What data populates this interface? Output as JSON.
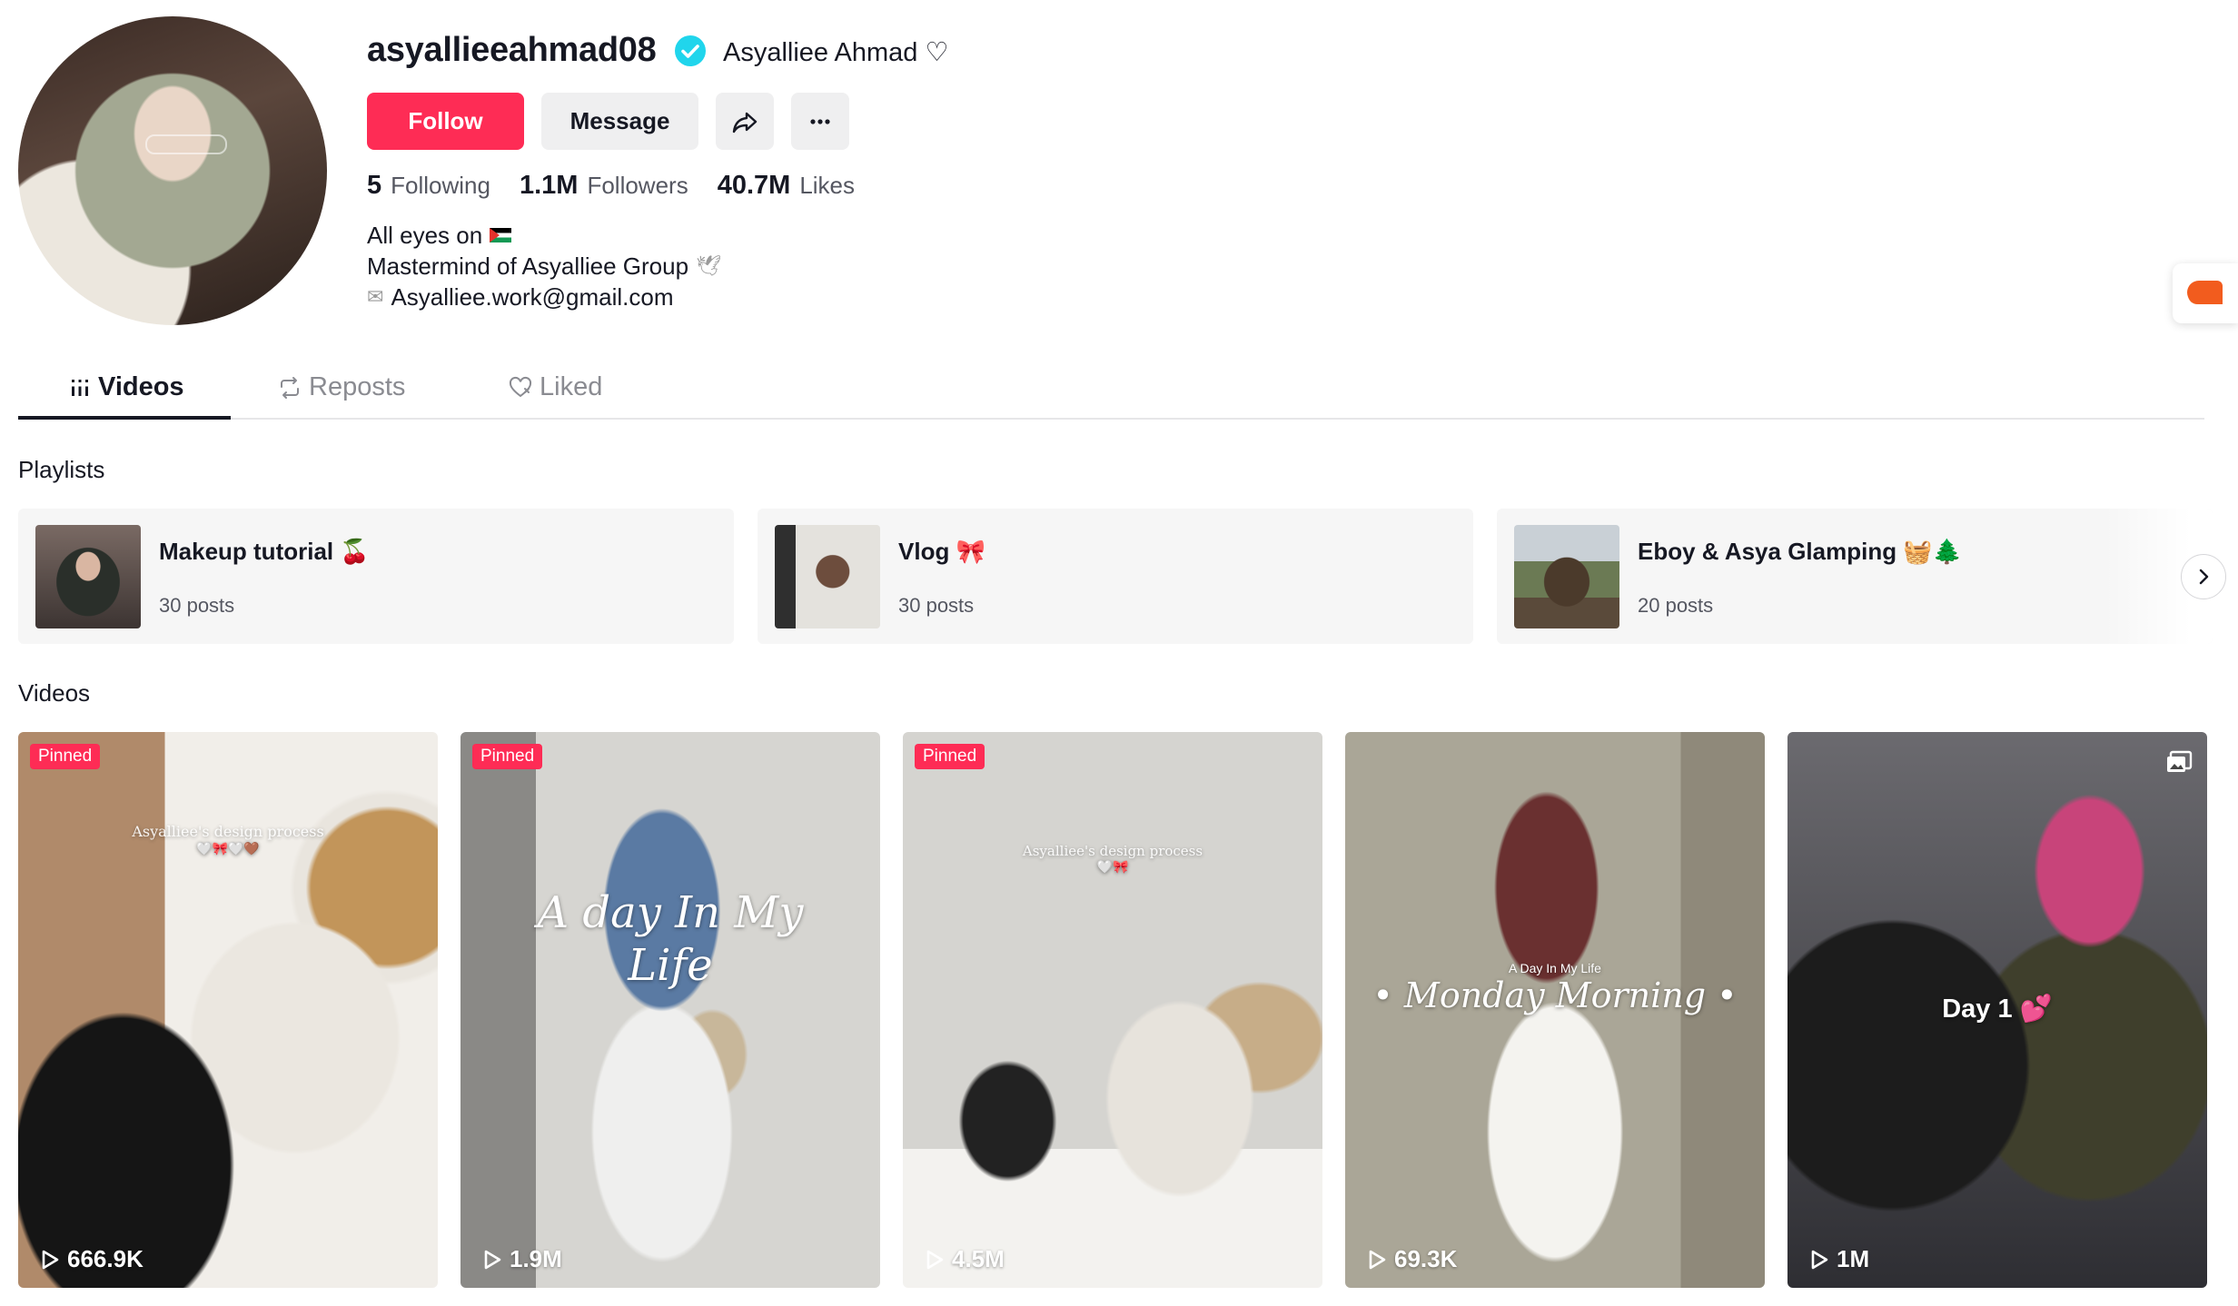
{
  "profile": {
    "username": "asyallieeahmad08",
    "nickname": "Asyalliee Ahmad ♡",
    "follow_label": "Follow",
    "message_label": "Message",
    "stats": {
      "following_count": "5",
      "following_label": "Following",
      "followers_count": "1.1M",
      "followers_label": "Followers",
      "likes_count": "40.7M",
      "likes_label": "Likes"
    },
    "bio": {
      "line1": "All eyes on",
      "line2": "Mastermind of Asyalliee Group",
      "line3": "Asyalliee.work@gmail.com"
    }
  },
  "tabs": {
    "videos": "Videos",
    "reposts": "Reposts",
    "liked": "Liked"
  },
  "playlists": {
    "title": "Playlists",
    "items": [
      {
        "name": "Makeup tutorial 🍒",
        "count": "30 posts"
      },
      {
        "name": "Vlog 🎀",
        "count": "30 posts"
      },
      {
        "name": "Eboy & Asya Glamping 🧺🌲",
        "count": "20 posts"
      }
    ]
  },
  "videos": {
    "title": "Videos",
    "pinned_label": "Pinned",
    "items": [
      {
        "views": "666.9K",
        "overlay": "Asyalliee's design process",
        "overlay2": "🤍🎀🤍🤎"
      },
      {
        "views": "1.9M",
        "overlay": "A day In My Life"
      },
      {
        "views": "4.5M",
        "overlay": "Asyalliee's design process",
        "overlay2": "🤍🎀"
      },
      {
        "views": "69.3K",
        "overlay": "A Day In My Life",
        "overlay2": "• Monday Morning •"
      },
      {
        "views": "1M",
        "overlay": "Day 1 💕"
      }
    ]
  },
  "colors": {
    "accent": "#fe2c55",
    "verified": "#20d5ec",
    "text": "#161823",
    "muted": "#555761"
  }
}
